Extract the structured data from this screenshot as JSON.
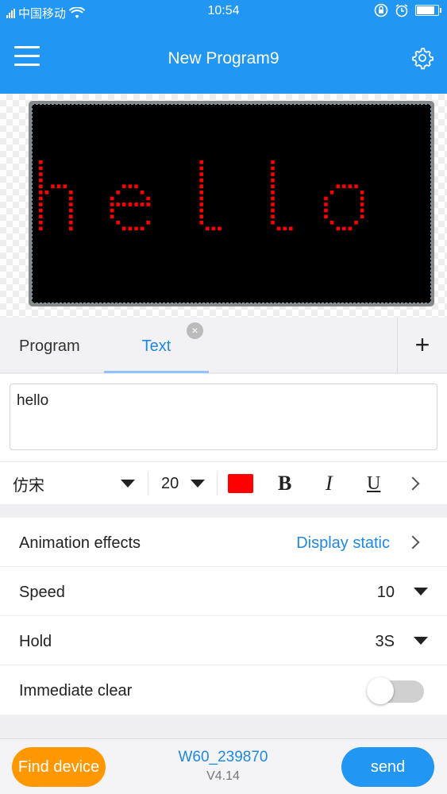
{
  "status_bar": {
    "carrier": "中国移动",
    "time": "10:54"
  },
  "header": {
    "title": "New Program9"
  },
  "led_preview": {
    "text": "hello",
    "text_color": "#ff0000",
    "background_color": "#000000"
  },
  "tabs": {
    "items": [
      {
        "label": "Program"
      },
      {
        "label": "Text"
      }
    ],
    "active": "Text",
    "close_symbol": "×",
    "add_symbol": "+"
  },
  "text_input": {
    "value": "hello"
  },
  "font_toolbar": {
    "font_name": "仿宋",
    "font_size": "20",
    "color": "#ff0000",
    "bold_label": "B",
    "italic_label": "I",
    "underline_label": "U"
  },
  "settings": {
    "animation": {
      "label": "Animation effects",
      "value": "Display static"
    },
    "speed": {
      "label": "Speed",
      "value": "10"
    },
    "hold": {
      "label": "Hold",
      "value": "3S"
    },
    "immediate_clear": {
      "label": "Immediate clear",
      "enabled": false
    }
  },
  "bottom_bar": {
    "find_device_label": "Find device",
    "device_name": "W60_239870",
    "version": "V4.14",
    "send_label": "send"
  },
  "colors": {
    "primary": "#2196f3",
    "accent_orange": "#ff9800",
    "link_blue": "#1e88e5"
  }
}
